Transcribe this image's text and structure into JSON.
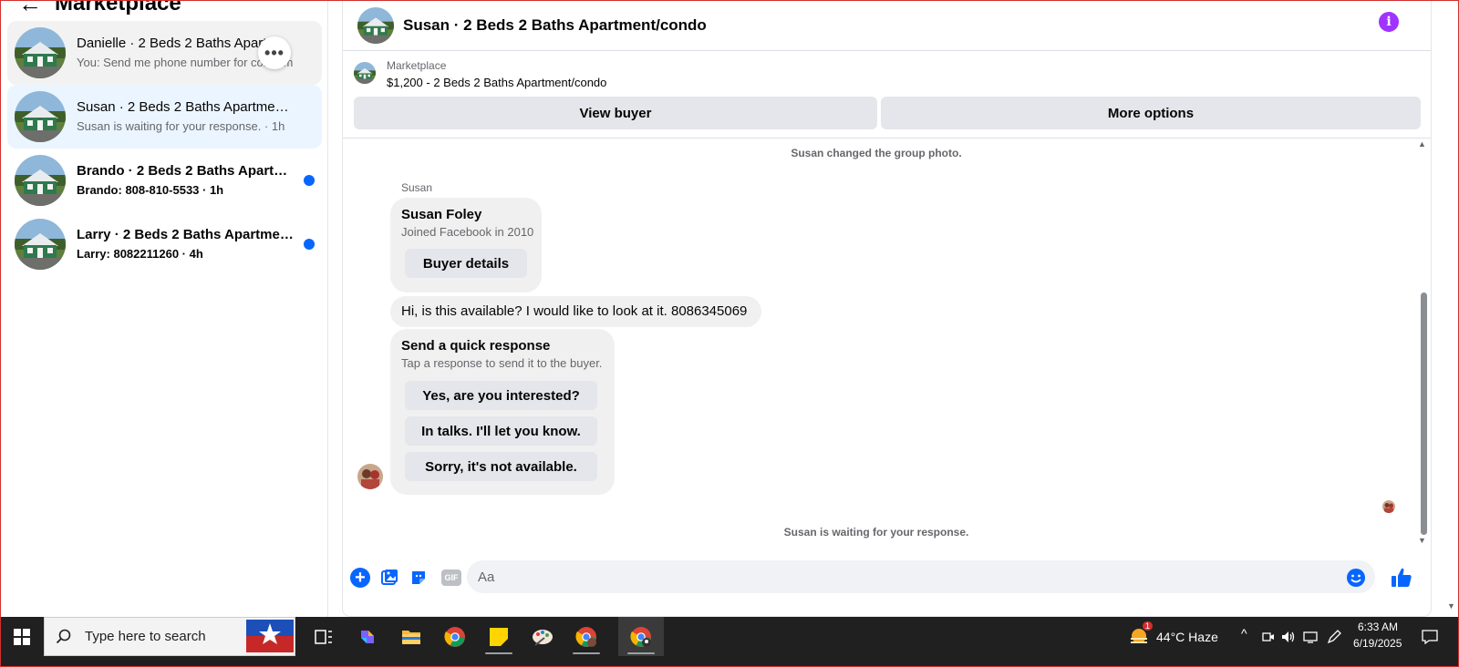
{
  "sidebar": {
    "title": "Marketplace",
    "conversations": [
      {
        "name": "Danielle · 2 Beds 2 Baths Apart...",
        "sub": "You: Send me phone number for con... m",
        "unread": false
      },
      {
        "name": "Susan · 2 Beds 2 Baths Apartment/...",
        "sub": "Susan is waiting for your response. · 1h",
        "unread": false
      },
      {
        "name": "Brando · 2 Beds 2 Baths Apartme...",
        "sub": "Brando: 808-810-5533 · 1h",
        "unread": true
      },
      {
        "name": "Larry · 2 Beds 2 Baths Apartment...",
        "sub": "Larry: 8082211260 · 4h",
        "unread": true
      }
    ],
    "more_options_glyph": "•••"
  },
  "chat": {
    "title": "Susan · 2 Beds 2 Baths Apartment/condo",
    "listing": {
      "source": "Marketplace",
      "price_line": "$1,200 - 2 Beds 2 Baths Apartment/condo",
      "view_buyer": "View buyer",
      "more_options": "More options"
    },
    "messages": {
      "system_photo": "Susan changed the group photo.",
      "sender": "Susan",
      "buyer_name": "Susan Foley",
      "buyer_joined": "Joined Facebook in 2010",
      "buyer_details": "Buyer details",
      "text": "Hi, is this available? I would like to look at it.   8086345069",
      "quick_title": "Send a quick response",
      "quick_sub": "Tap a response to send it to the buyer.",
      "quick_replies": [
        "Yes, are you interested?",
        "In talks. I'll let you know.",
        "Sorry, it's not available."
      ],
      "waiting": "Susan is waiting for your response."
    },
    "composer": {
      "placeholder": "Aa",
      "gif_label": "GIF"
    }
  },
  "taskbar": {
    "search_placeholder": "Type here to search",
    "weather": "44°C  Haze",
    "weather_badge": "1",
    "time": "6:33 AM",
    "date": "6/19/2025"
  },
  "colors": {
    "messenger_blue": "#0866ff",
    "info_purple": "#a033ff",
    "bubble_gray": "#f0f0f0",
    "button_gray": "#e4e6eb"
  }
}
